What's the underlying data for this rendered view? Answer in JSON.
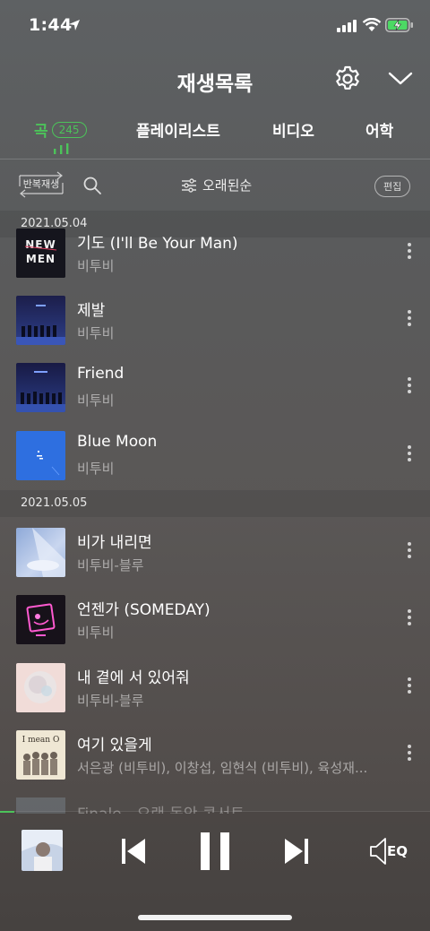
{
  "status": {
    "time": "1:44"
  },
  "header": {
    "title": "재생목록"
  },
  "tabs": {
    "songs": {
      "label": "곡",
      "count": "245"
    },
    "playlist": "플레이리스트",
    "video": "비디오",
    "language": "어학"
  },
  "toolbar": {
    "repeat_label": "반복재생",
    "sort_label": "오래된순",
    "edit_label": "편집"
  },
  "groups": [
    {
      "date": "2021.05.04",
      "songs": [
        {
          "title": "기도 (I'll Be Your Man)",
          "artist": "비투비",
          "art_text": "NEW MEN"
        },
        {
          "title": "제발",
          "artist": "비투비"
        },
        {
          "title": "Friend",
          "artist": "비투비"
        },
        {
          "title": "Blue Moon",
          "artist": "비투비"
        }
      ]
    },
    {
      "date": "2021.05.05",
      "songs": [
        {
          "title": "비가 내리면",
          "artist": "비투비-블루"
        },
        {
          "title": "언젠가 (SOMEDAY)",
          "artist": "비투비"
        },
        {
          "title": "내 곁에 서 있어줘",
          "artist": "비투비-블루"
        },
        {
          "title": "여기 있을게",
          "artist": "서은광 (비투비), 이창섭, 임현식 (비투비), 육성재...",
          "art_text": "I mean O"
        }
      ]
    }
  ],
  "partial_row_title": "Finale - 오랜 동안 콘서트",
  "player": {
    "eq_label": "EQ"
  },
  "colors": {
    "accent": "#4cc35a"
  }
}
